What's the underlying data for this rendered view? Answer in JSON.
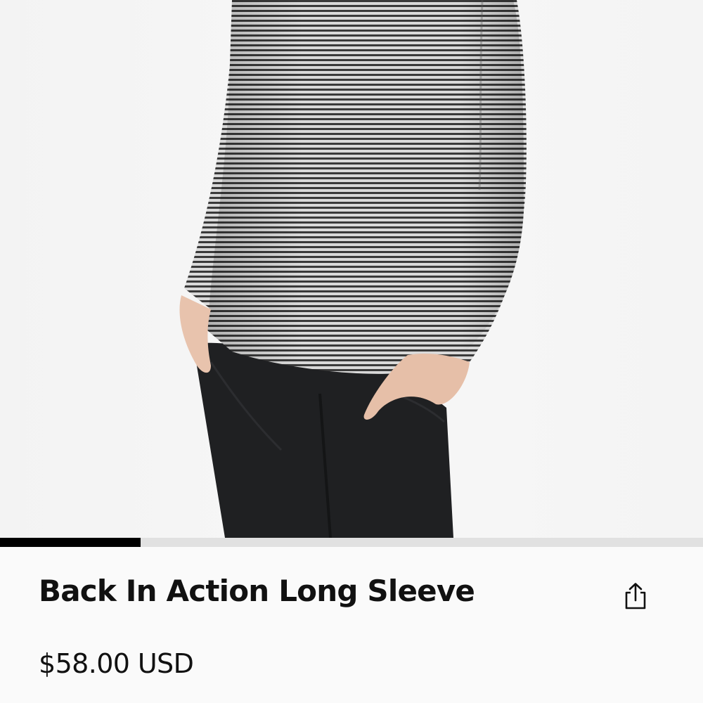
{
  "product": {
    "image_name": "product-photo",
    "title": "Back In Action Long Sleeve",
    "price": "$58.00 USD"
  },
  "carousel": {
    "progress": 0.2,
    "track_color": "#e1e1e1",
    "fill_color": "#000000"
  },
  "share": {
    "icon": "share-icon"
  },
  "colors": {
    "background": "#fafafa",
    "text": "#111111"
  }
}
